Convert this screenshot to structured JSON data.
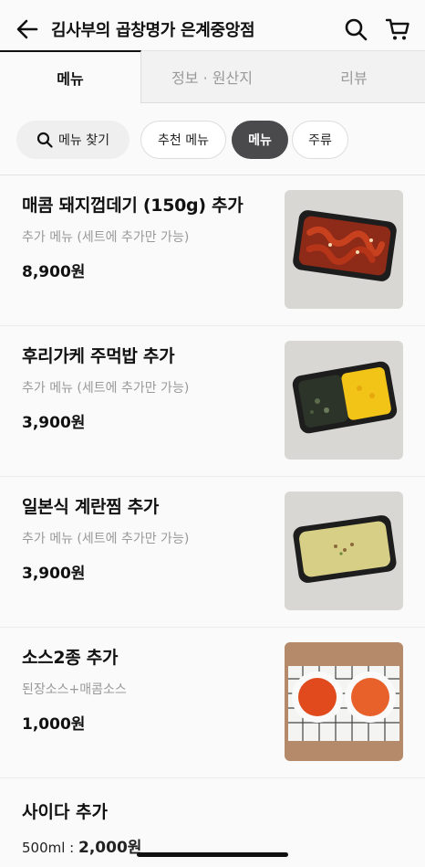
{
  "header": {
    "title": "김사부의 곱창명가 은계중앙점"
  },
  "tabs": [
    {
      "label": "메뉴",
      "active": true
    },
    {
      "label": "정보 · 원산지",
      "active": false
    },
    {
      "label": "리뷰",
      "active": false
    }
  ],
  "chips": {
    "search_label": "메뉴 찾기",
    "items": [
      {
        "label": "추천 메뉴",
        "selected": false
      },
      {
        "label": "메뉴",
        "selected": true
      },
      {
        "label": "주류",
        "selected": false
      }
    ]
  },
  "menu_items": [
    {
      "name": "매콤 돼지껍데기 (150g) 추가",
      "desc": "추가 메뉴 (세트에 추가만 가능)",
      "price": "8,900원"
    },
    {
      "name": "후리가케 주먹밥 추가",
      "desc": "추가 메뉴 (세트에 추가만 가능)",
      "price": "3,900원"
    },
    {
      "name": "일본식 계란찜 추가",
      "desc": "추가 메뉴 (세트에 추가만 가능)",
      "price": "3,900원"
    },
    {
      "name": "소스2종 추가",
      "desc": "된장소스+매콤소스",
      "price": "1,000원"
    }
  ],
  "last_item": {
    "name": "사이다 추가",
    "volume": "500ml : ",
    "price": "2,000원"
  },
  "colors": {
    "selected_chip": "#4a4a4c",
    "muted_text": "#999999"
  }
}
